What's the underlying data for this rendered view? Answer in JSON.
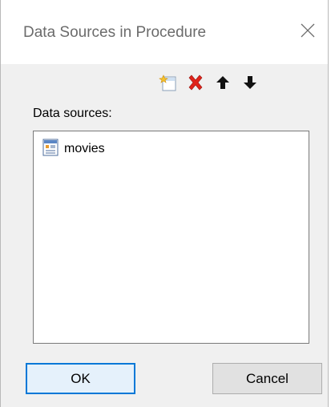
{
  "dialog": {
    "title": "Data Sources in Procedure"
  },
  "toolbar": {
    "icons": [
      "new-datasource-icon",
      "delete-icon",
      "move-up-icon",
      "move-down-icon"
    ]
  },
  "data_sources": {
    "label": "Data sources:",
    "items": [
      {
        "label": "movies",
        "icon": "datasource-icon"
      }
    ]
  },
  "buttons": {
    "ok": "OK",
    "cancel": "Cancel"
  },
  "colors": {
    "delete": "#e0241b",
    "focus_border": "#0078d7",
    "ok_background": "#e5f1fb"
  }
}
